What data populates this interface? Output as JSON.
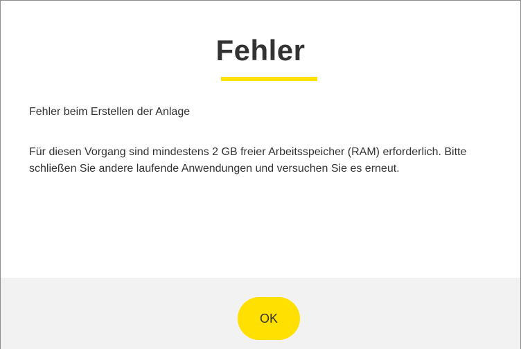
{
  "dialog": {
    "title": "Fehler",
    "subtitle": "Fehler beim Erstellen der Anlage",
    "message": "Für diesen Vorgang sind mindestens 2 GB freier Arbeitsspeicher (RAM) erforderlich. Bitte schließen Sie andere laufende Anwendungen und versuchen Sie es erneut.",
    "ok_label": "OK"
  },
  "colors": {
    "accent": "#ffe000",
    "text": "#333333",
    "footer_bg": "#f2f2f2"
  }
}
